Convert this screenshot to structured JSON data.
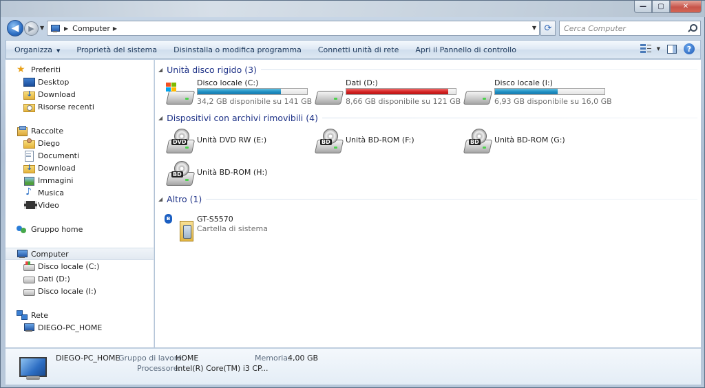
{
  "window": {
    "minimize_label": "—",
    "maximize_label": "▢",
    "close_label": "✕"
  },
  "nav": {
    "back_label": "◀",
    "forward_label": "▶"
  },
  "address": {
    "path": "Computer",
    "search_placeholder": "Cerca Computer"
  },
  "toolbar": {
    "organize": "Organizza",
    "system_properties": "Proprietà del sistema",
    "uninstall": "Disinstalla o modifica programma",
    "map_drive": "Connetti unità di rete",
    "control_panel": "Apri il Pannello di controllo",
    "help_label": "?"
  },
  "sidebar": {
    "favorites": {
      "label": "Preferiti",
      "items": [
        "Desktop",
        "Download",
        "Risorse recenti"
      ]
    },
    "libraries": {
      "label": "Raccolte",
      "items": [
        "Diego",
        "Documenti",
        "Download",
        "Immagini",
        "Musica",
        "Video"
      ]
    },
    "homegroup": {
      "label": "Gruppo home"
    },
    "computer": {
      "label": "Computer",
      "items": [
        "Disco locale (C:)",
        "Dati (D:)",
        "Disco locale (I:)"
      ]
    },
    "network": {
      "label": "Rete",
      "items": [
        "DIEGO-PC_HOME"
      ]
    }
  },
  "groups": {
    "hdd": {
      "title": "Unità disco rigido (3)",
      "drives": [
        {
          "name": "Disco locale (C:)",
          "free": "34,2 GB disponibile su 141 GB",
          "used_fraction": 0.76,
          "warning": false
        },
        {
          "name": "Dati (D:)",
          "free": "8,66 GB disponibile su 121 GB",
          "used_fraction": 0.93,
          "warning": true
        },
        {
          "name": "Disco locale (I:)",
          "free": "6,93 GB disponibile su 16,0 GB",
          "used_fraction": 0.57,
          "warning": false
        }
      ]
    },
    "removable": {
      "title": "Dispositivi con archivi rimovibili (4)",
      "devices": [
        {
          "name": "Unità DVD RW (E:)",
          "badge": "DVD"
        },
        {
          "name": "Unità BD-ROM (F:)",
          "badge": "BD"
        },
        {
          "name": "Unità BD-ROM (G:)",
          "badge": "BD"
        },
        {
          "name": "Unità BD-ROM (H:)",
          "badge": "BD"
        }
      ]
    },
    "other": {
      "title": "Altro (1)",
      "items": [
        {
          "name": "GT-S5570",
          "sub": "Cartella di sistema",
          "badge": "ʙ"
        }
      ]
    }
  },
  "details": {
    "computer_name": "DIEGO-PC_HOME",
    "workgroup_label": "Gruppo di lavoro:",
    "workgroup_value": "HOME",
    "memory_label": "Memoria:",
    "memory_value": "4,00 GB",
    "processor_label": "Processore:",
    "processor_value": "Intel(R) Core(TM) i3 CP..."
  },
  "colors": {
    "group_header": "#1e3287",
    "bar_normal": "#1f8fc3",
    "bar_warning": "#d42323"
  }
}
